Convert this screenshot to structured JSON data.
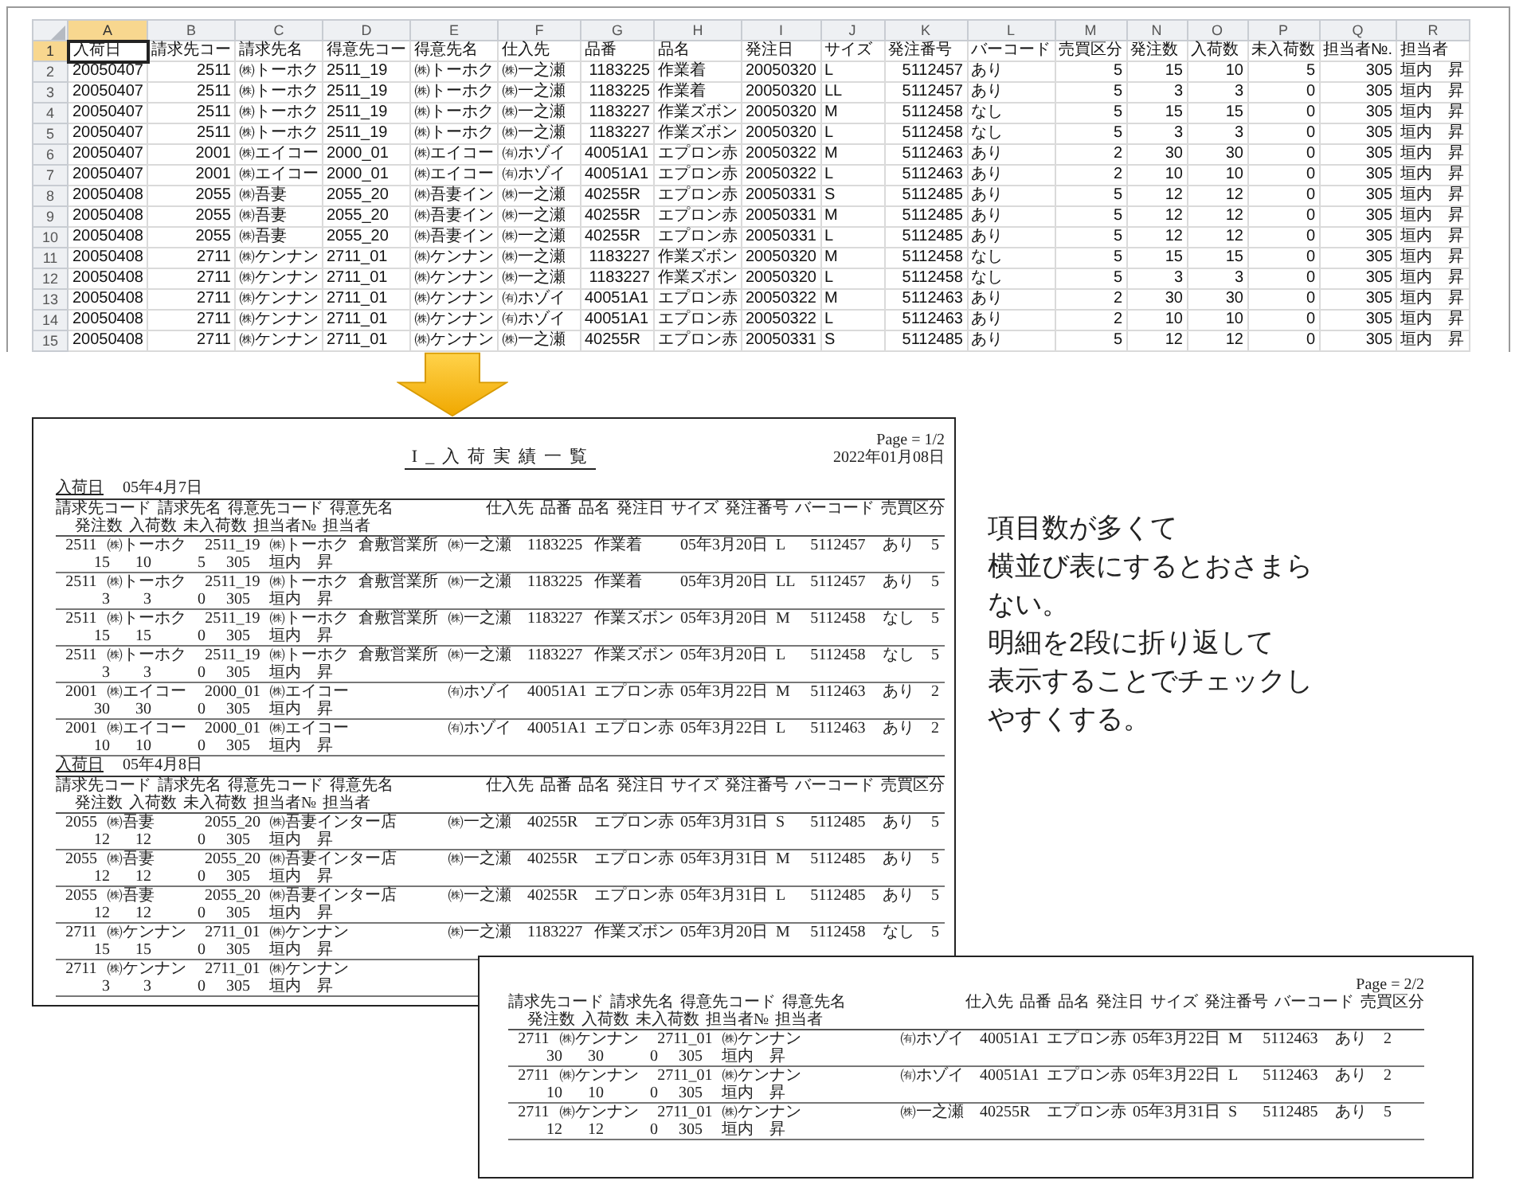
{
  "spreadsheet": {
    "columns": [
      {
        "label": "A",
        "selected": true
      },
      {
        "label": "B",
        "selected": false
      },
      {
        "label": "C",
        "selected": false
      },
      {
        "label": "D",
        "selected": false
      },
      {
        "label": "E",
        "selected": false
      },
      {
        "label": "F",
        "selected": false
      },
      {
        "label": "G",
        "selected": false
      },
      {
        "label": "H",
        "selected": false
      },
      {
        "label": "I",
        "selected": false
      },
      {
        "label": "J",
        "selected": false
      },
      {
        "label": "K",
        "selected": false
      },
      {
        "label": "L",
        "selected": false
      },
      {
        "label": "M",
        "selected": false
      },
      {
        "label": "N",
        "selected": false
      },
      {
        "label": "O",
        "selected": false
      },
      {
        "label": "P",
        "selected": false
      },
      {
        "label": "Q",
        "selected": false
      },
      {
        "label": "R",
        "selected": false
      }
    ],
    "rows": [
      {
        "number": "1",
        "selected": true,
        "cells": [
          "入荷日",
          "請求先コー",
          "請求先名",
          "得意先コー",
          "得意先名",
          "仕入先",
          "品番",
          "品名",
          "発注日",
          "サイズ",
          "発注番号",
          "バーコード",
          "売買区分",
          "発注数",
          "入荷数",
          "未入荷数",
          "担当者№.",
          "担当者"
        ]
      },
      {
        "number": "2",
        "selected": false,
        "cells": [
          "20050407",
          "2511",
          "㈱トーホク",
          "2511_19",
          "㈱トーホク",
          "㈱一之瀬",
          "1183225",
          "作業着",
          "20050320",
          "L",
          "5112457",
          "あり",
          "5",
          "15",
          "10",
          "5",
          "305",
          "垣内　昇"
        ]
      },
      {
        "number": "3",
        "selected": false,
        "cells": [
          "20050407",
          "2511",
          "㈱トーホク",
          "2511_19",
          "㈱トーホク",
          "㈱一之瀬",
          "1183225",
          "作業着",
          "20050320",
          "LL",
          "5112457",
          "あり",
          "5",
          "3",
          "3",
          "0",
          "305",
          "垣内　昇"
        ]
      },
      {
        "number": "4",
        "selected": false,
        "cells": [
          "20050407",
          "2511",
          "㈱トーホク",
          "2511_19",
          "㈱トーホク",
          "㈱一之瀬",
          "1183227",
          "作業ズボン",
          "20050320",
          "M",
          "5112458",
          "なし",
          "5",
          "15",
          "15",
          "0",
          "305",
          "垣内　昇"
        ]
      },
      {
        "number": "5",
        "selected": false,
        "cells": [
          "20050407",
          "2511",
          "㈱トーホク",
          "2511_19",
          "㈱トーホク",
          "㈱一之瀬",
          "1183227",
          "作業ズボン",
          "20050320",
          "L",
          "5112458",
          "なし",
          "5",
          "3",
          "3",
          "0",
          "305",
          "垣内　昇"
        ]
      },
      {
        "number": "6",
        "selected": false,
        "cells": [
          "20050407",
          "2001",
          "㈱エイコー",
          "2000_01",
          "㈱エイコー",
          "㈲ホゾイ",
          "40051A1",
          "エプロン赤",
          "20050322",
          "M",
          "5112463",
          "あり",
          "2",
          "30",
          "30",
          "0",
          "305",
          "垣内　昇"
        ]
      },
      {
        "number": "7",
        "selected": false,
        "cells": [
          "20050407",
          "2001",
          "㈱エイコー",
          "2000_01",
          "㈱エイコー",
          "㈲ホゾイ",
          "40051A1",
          "エプロン赤",
          "20050322",
          "L",
          "5112463",
          "あり",
          "2",
          "10",
          "10",
          "0",
          "305",
          "垣内　昇"
        ]
      },
      {
        "number": "8",
        "selected": false,
        "cells": [
          "20050408",
          "2055",
          "㈱吾妻",
          "2055_20",
          "㈱吾妻イン",
          "㈱一之瀬",
          "40255R",
          "エプロン赤",
          "20050331",
          "S",
          "5112485",
          "あり",
          "5",
          "12",
          "12",
          "0",
          "305",
          "垣内　昇"
        ]
      },
      {
        "number": "9",
        "selected": false,
        "cells": [
          "20050408",
          "2055",
          "㈱吾妻",
          "2055_20",
          "㈱吾妻イン",
          "㈱一之瀬",
          "40255R",
          "エプロン赤",
          "20050331",
          "M",
          "5112485",
          "あり",
          "5",
          "12",
          "12",
          "0",
          "305",
          "垣内　昇"
        ]
      },
      {
        "number": "10",
        "selected": false,
        "cells": [
          "20050408",
          "2055",
          "㈱吾妻",
          "2055_20",
          "㈱吾妻イン",
          "㈱一之瀬",
          "40255R",
          "エプロン赤",
          "20050331",
          "L",
          "5112485",
          "あり",
          "5",
          "12",
          "12",
          "0",
          "305",
          "垣内　昇"
        ]
      },
      {
        "number": "11",
        "selected": false,
        "cells": [
          "20050408",
          "2711",
          "㈱ケンナン",
          "2711_01",
          "㈱ケンナン",
          "㈱一之瀬",
          "1183227",
          "作業ズボン",
          "20050320",
          "M",
          "5112458",
          "なし",
          "5",
          "15",
          "15",
          "0",
          "305",
          "垣内　昇"
        ]
      },
      {
        "number": "12",
        "selected": false,
        "cells": [
          "20050408",
          "2711",
          "㈱ケンナン",
          "2711_01",
          "㈱ケンナン",
          "㈱一之瀬",
          "1183227",
          "作業ズボン",
          "20050320",
          "L",
          "5112458",
          "なし",
          "5",
          "3",
          "3",
          "0",
          "305",
          "垣内　昇"
        ]
      },
      {
        "number": "13",
        "selected": false,
        "cells": [
          "20050408",
          "2711",
          "㈱ケンナン",
          "2711_01",
          "㈱ケンナン",
          "㈲ホゾイ",
          "40051A1",
          "エプロン赤",
          "20050322",
          "M",
          "5112463",
          "あり",
          "2",
          "30",
          "30",
          "0",
          "305",
          "垣内　昇"
        ]
      },
      {
        "number": "14",
        "selected": false,
        "cells": [
          "20050408",
          "2711",
          "㈱ケンナン",
          "2711_01",
          "㈱ケンナン",
          "㈲ホゾイ",
          "40051A1",
          "エプロン赤",
          "20050322",
          "L",
          "5112463",
          "あり",
          "2",
          "10",
          "10",
          "0",
          "305",
          "垣内　昇"
        ]
      },
      {
        "number": "15",
        "selected": false,
        "cells": [
          "20050408",
          "2711",
          "㈱ケンナン",
          "2711_01",
          "㈱ケンナン",
          "㈱一之瀬",
          "40255R",
          "エプロン赤",
          "20050331",
          "S",
          "5112485",
          "あり",
          "5",
          "12",
          "12",
          "0",
          "305",
          "垣内　昇"
        ]
      }
    ]
  },
  "report_pages": [
    {
      "page": "Page = 1/2",
      "date": "2022年01月08日",
      "title": "I_入荷実績一覧",
      "groups": [
        {
          "date_label": "入荷日",
          "date": "05年4月7日",
          "header_line1": [
            "請求先コード",
            "請求先名",
            "得意先コード",
            "得意先名",
            "仕入先",
            "品番",
            "品名",
            "発注日",
            "サイズ",
            "発注番号",
            "バーコード",
            "売買区分"
          ],
          "header_line2": [
            "発注数",
            "入荷数",
            "未入荷数",
            "担当者№",
            "担当者"
          ],
          "records": [
            {
              "line1": [
                "2511",
                "㈱トーホク",
                "2511_19",
                "㈱トーホク",
                "㈱一之瀬",
                "1183225",
                "作業着",
                "05年3月20日",
                "L",
                "5112457",
                "あり",
                "5"
              ],
              "branch": "倉敷営業所",
              "line2": [
                "15",
                "10",
                "5",
                "305",
                "垣内　昇"
              ]
            },
            {
              "line1": [
                "2511",
                "㈱トーホク",
                "2511_19",
                "㈱トーホク",
                "㈱一之瀬",
                "1183225",
                "作業着",
                "05年3月20日",
                "LL",
                "5112457",
                "あり",
                "5"
              ],
              "branch": "倉敷営業所",
              "line2": [
                "3",
                "3",
                "0",
                "305",
                "垣内　昇"
              ]
            },
            {
              "line1": [
                "2511",
                "㈱トーホク",
                "2511_19",
                "㈱トーホク",
                "㈱一之瀬",
                "1183227",
                "作業ズボン",
                "05年3月20日",
                "M",
                "5112458",
                "なし",
                "5"
              ],
              "branch": "倉敷営業所",
              "line2": [
                "15",
                "15",
                "0",
                "305",
                "垣内　昇"
              ]
            },
            {
              "line1": [
                "2511",
                "㈱トーホク",
                "2511_19",
                "㈱トーホク",
                "㈱一之瀬",
                "1183227",
                "作業ズボン",
                "05年3月20日",
                "L",
                "5112458",
                "なし",
                "5"
              ],
              "branch": "倉敷営業所",
              "line2": [
                "3",
                "3",
                "0",
                "305",
                "垣内　昇"
              ]
            },
            {
              "line1": [
                "2001",
                "㈱エイコー",
                "2000_01",
                "㈱エイコー",
                "㈲ホゾイ",
                "40051A1",
                "エプロン赤",
                "05年3月22日",
                "M",
                "5112463",
                "あり",
                "2"
              ],
              "line2": [
                "30",
                "30",
                "0",
                "305",
                "垣内　昇"
              ]
            },
            {
              "line1": [
                "2001",
                "㈱エイコー",
                "2000_01",
                "㈱エイコー",
                "㈲ホゾイ",
                "40051A1",
                "エプロン赤",
                "05年3月22日",
                "L",
                "5112463",
                "あり",
                "2"
              ],
              "line2": [
                "10",
                "10",
                "0",
                "305",
                "垣内　昇"
              ]
            }
          ]
        },
        {
          "date_label": "入荷日",
          "date": "05年4月8日",
          "header_line1": [
            "請求先コード",
            "請求先名",
            "得意先コード",
            "得意先名",
            "仕入先",
            "品番",
            "品名",
            "発注日",
            "サイズ",
            "発注番号",
            "バーコード",
            "売買区分"
          ],
          "header_line2": [
            "発注数",
            "入荷数",
            "未入荷数",
            "担当者№",
            "担当者"
          ],
          "records": [
            {
              "line1": [
                "2055",
                "㈱吾妻",
                "2055_20",
                "㈱吾妻インター店",
                "㈱一之瀬",
                "40255R",
                "エプロン赤",
                "05年3月31日",
                "S",
                "5112485",
                "あり",
                "5"
              ],
              "line2": [
                "12",
                "12",
                "0",
                "305",
                "垣内　昇"
              ]
            },
            {
              "line1": [
                "2055",
                "㈱吾妻",
                "2055_20",
                "㈱吾妻インター店",
                "㈱一之瀬",
                "40255R",
                "エプロン赤",
                "05年3月31日",
                "M",
                "5112485",
                "あり",
                "5"
              ],
              "line2": [
                "12",
                "12",
                "0",
                "305",
                "垣内　昇"
              ]
            },
            {
              "line1": [
                "2055",
                "㈱吾妻",
                "2055_20",
                "㈱吾妻インター店",
                "㈱一之瀬",
                "40255R",
                "エプロン赤",
                "05年3月31日",
                "L",
                "5112485",
                "あり",
                "5"
              ],
              "line2": [
                "12",
                "12",
                "0",
                "305",
                "垣内　昇"
              ]
            },
            {
              "line1": [
                "2711",
                "㈱ケンナン",
                "2711_01",
                "㈱ケンナン",
                "㈱一之瀬",
                "1183227",
                "作業ズボン",
                "05年3月20日",
                "M",
                "5112458",
                "なし",
                "5"
              ],
              "line2": [
                "15",
                "15",
                "0",
                "305",
                "垣内　昇"
              ]
            },
            {
              "line1": [
                "2711",
                "㈱ケンナン",
                "2711_01",
                "㈱ケンナン"
              ],
              "line2": [
                "3",
                "3",
                "0",
                "305",
                "垣内　昇"
              ]
            }
          ]
        }
      ]
    },
    {
      "page": "Page = 2/2",
      "groups": [
        {
          "header_line1": [
            "請求先コード",
            "請求先名",
            "得意先コード",
            "得意先名",
            "仕入先",
            "品番",
            "品名",
            "発注日",
            "サイズ",
            "発注番号",
            "バーコード",
            "売買区分"
          ],
          "header_line2": [
            "発注数",
            "入荷数",
            "未入荷数",
            "担当者№",
            "担当者"
          ],
          "records": [
            {
              "line1": [
                "2711",
                "㈱ケンナン",
                "2711_01",
                "㈱ケンナン",
                "㈲ホゾイ",
                "40051A1",
                "エプロン赤",
                "05年3月22日",
                "M",
                "5112463",
                "あり",
                "2"
              ],
              "line2": [
                "30",
                "30",
                "0",
                "305",
                "垣内　昇"
              ]
            },
            {
              "line1": [
                "2711",
                "㈱ケンナン",
                "2711_01",
                "㈱ケンナン",
                "㈲ホゾイ",
                "40051A1",
                "エプロン赤",
                "05年3月22日",
                "L",
                "5112463",
                "あり",
                "2"
              ],
              "line2": [
                "10",
                "10",
                "0",
                "305",
                "垣内　昇"
              ]
            },
            {
              "line1": [
                "2711",
                "㈱ケンナン",
                "2711_01",
                "㈱ケンナン",
                "㈱一之瀬",
                "40255R",
                "エプロン赤",
                "05年3月31日",
                "S",
                "5112485",
                "あり",
                "5"
              ],
              "line2": [
                "12",
                "12",
                "0",
                "305",
                "垣内　昇"
              ]
            }
          ]
        }
      ]
    }
  ],
  "note": {
    "lines": [
      "項目数が多くて",
      "横並び表にするとおさまらない。",
      "明細を2段に折り返して",
      "表示することでチェックしやすくする。"
    ]
  }
}
